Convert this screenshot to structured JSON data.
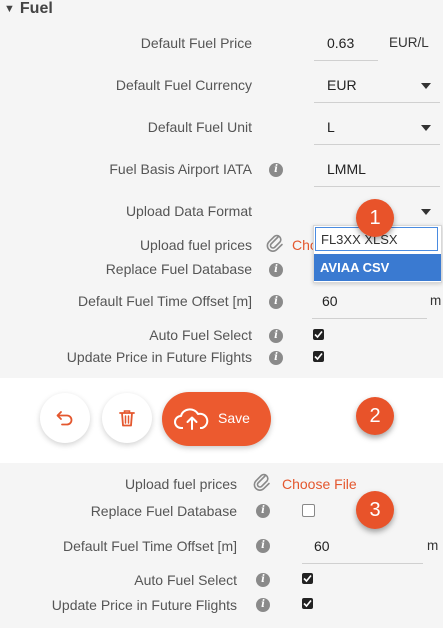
{
  "section": {
    "toggle": "▼",
    "title": "Fuel"
  },
  "form1": {
    "default_fuel_price": {
      "label": "Default Fuel Price",
      "value": "0.63",
      "unit": "EUR/L"
    },
    "default_fuel_currency": {
      "label": "Default Fuel Currency",
      "value": "EUR"
    },
    "default_fuel_unit": {
      "label": "Default Fuel Unit",
      "value": "L"
    },
    "fuel_basis_airport": {
      "label": "Fuel Basis Airport IATA",
      "value": "LMML"
    },
    "upload_data_format": {
      "label": "Upload Data Format",
      "options": [
        "FL3XX XLSX",
        "AVIAA CSV"
      ],
      "highlighted": "AVIAA CSV"
    },
    "upload_fuel_prices": {
      "label": "Upload fuel prices",
      "link_partial": "Cho"
    },
    "replace_fuel_database": {
      "label": "Replace Fuel Database"
    },
    "time_offset": {
      "label": "Default Fuel Time Offset [m]",
      "value": "60",
      "unit": "m"
    },
    "auto_fuel_select": {
      "label": "Auto Fuel Select",
      "checked": true
    },
    "update_price": {
      "label": "Update Price in Future Flights",
      "checked": true
    }
  },
  "actions": {
    "undo_icon": "undo-icon",
    "delete_icon": "trash-icon",
    "save_label": "Save",
    "save_icon": "cloud-upload-icon"
  },
  "form3": {
    "upload_fuel_prices": {
      "label": "Upload fuel prices",
      "link": "Choose File"
    },
    "replace_fuel_database": {
      "label": "Replace Fuel Database",
      "checked": false
    },
    "time_offset": {
      "label": "Default Fuel Time Offset [m]",
      "value": "60",
      "unit": "m"
    },
    "auto_fuel_select": {
      "label": "Auto Fuel Select",
      "checked": true
    },
    "update_price": {
      "label": "Update Price in Future Flights",
      "checked": true
    }
  },
  "badges": [
    "1",
    "2",
    "3"
  ],
  "colors": {
    "accent": "#ec5a2f",
    "badge": "#e8532a",
    "dropdown_highlight": "#3a7ad1",
    "link": "#e4572e"
  }
}
